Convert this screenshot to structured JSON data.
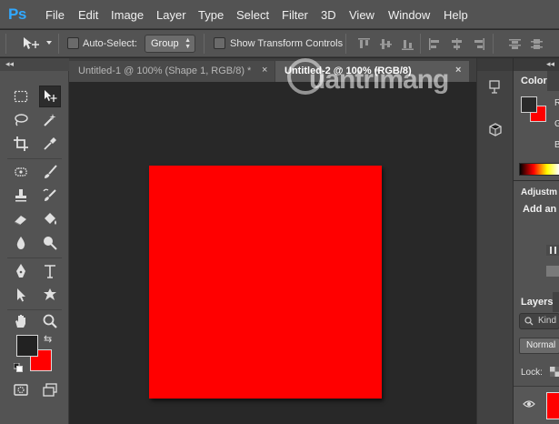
{
  "app": {
    "logo": "Ps",
    "menu": [
      "File",
      "Edit",
      "Image",
      "Layer",
      "Type",
      "Select",
      "Filter",
      "3D",
      "View",
      "Window",
      "Help"
    ]
  },
  "options": {
    "auto_select_label": "Auto-Select:",
    "group_value": "Group",
    "show_transform_label": "Show Transform Controls"
  },
  "tabs": [
    {
      "label": "Untitled-1 @ 100% (Shape 1, RGB/8) *",
      "close": "×"
    },
    {
      "label": "Untitled-2 @ 100% (RGB/8)",
      "close": "×"
    }
  ],
  "toolbar": {
    "collapse": "◂◂",
    "swap_icon": "⇆"
  },
  "colors": {
    "foreground": "#222222",
    "background": "#ff0000",
    "document_fill": "#ff0000"
  },
  "watermark": "uantrimang",
  "panels": {
    "collapse": "◂◂",
    "color_tab": "Color",
    "slider_r": "R",
    "slider_g": "G",
    "slider_b": "B",
    "adjustments_tab": "Adjustm",
    "adjustments_text": "Add an a",
    "layers_tab": "Layers",
    "kind_label": "Kind",
    "blend_mode": "Normal",
    "lock_label": "Lock:"
  }
}
